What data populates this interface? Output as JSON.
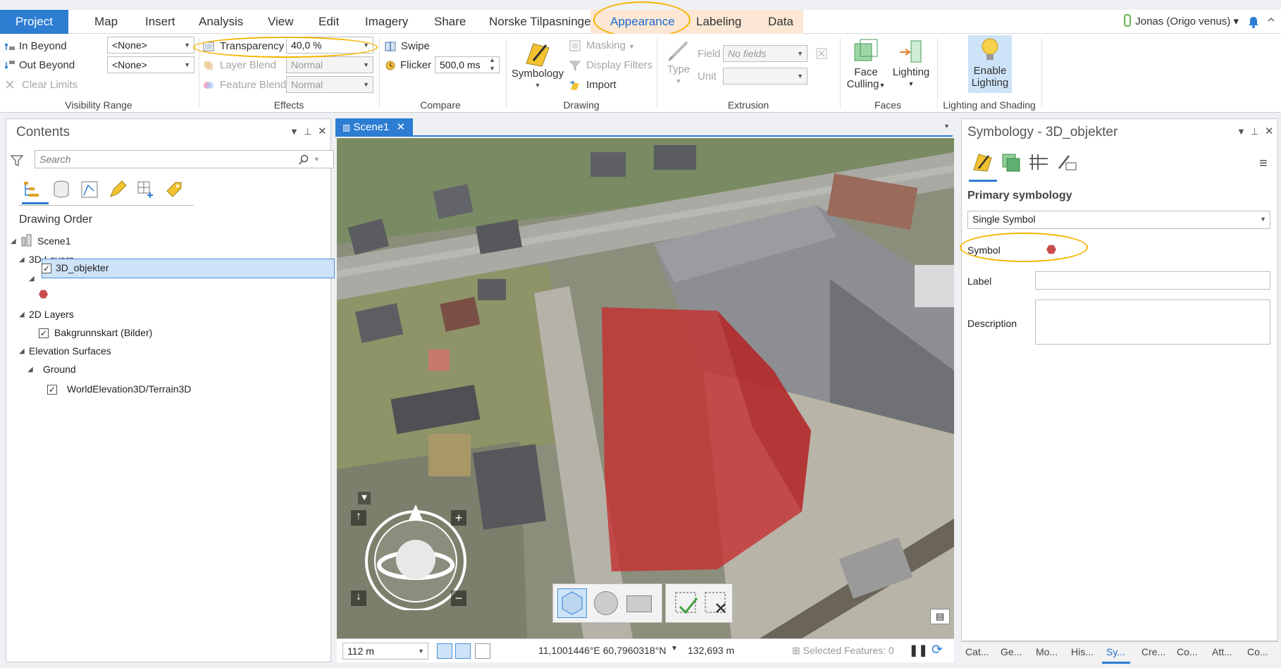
{
  "tabs": {
    "project": "Project",
    "map": "Map",
    "insert": "Insert",
    "analysis": "Analysis",
    "view": "View",
    "edit": "Edit",
    "imagery": "Imagery",
    "share": "Share",
    "norske": "Norske Tilpasninger",
    "appearance": "Appearance",
    "labeling": "Labeling",
    "data": "Data"
  },
  "user": {
    "name": "Jonas (Origo venus)",
    "caret": "▾"
  },
  "ribbon": {
    "visibility": {
      "in_beyond": "In Beyond",
      "out_beyond": "Out Beyond",
      "clear_limits": "Clear Limits",
      "in_value": "<None>",
      "out_value": "<None>",
      "label": "Visibility Range"
    },
    "effects": {
      "transparency": "Transparency",
      "transparency_value": "40,0 %",
      "layer_blend": "Layer Blend",
      "layer_blend_value": "Normal",
      "feature_blend": "Feature Blend",
      "feature_blend_value": "Normal",
      "label": "Effects"
    },
    "compare": {
      "swipe": "Swipe",
      "flicker": "Flicker",
      "flicker_value": "500,0  ms",
      "label": "Compare"
    },
    "drawing": {
      "symbology": "Symbology",
      "masking": "Masking",
      "display_filters": "Display Filters",
      "import": "Import",
      "label": "Drawing"
    },
    "extrusion": {
      "type": "Type",
      "field": "Field",
      "field_value": "No fields",
      "unit": "Unit",
      "label": "Extrusion"
    },
    "faces": {
      "face_culling_1": "Face",
      "face_culling_2": "Culling",
      "lighting": "Lighting",
      "label": "Faces"
    },
    "lighting_shading": {
      "enable_1": "Enable",
      "enable_2": "Lighting",
      "label": "Lighting and Shading"
    }
  },
  "contents": {
    "title": "Contents",
    "search_placeholder": "Search",
    "drawing_order": "Drawing Order",
    "scene": "Scene1",
    "layers_3d": "3D Layers",
    "layer_3d_item": "3D_objekter",
    "layers_2d": "2D Layers",
    "layer_2d_item": "Bakgrunnskart (Bilder)",
    "elevation": "Elevation Surfaces",
    "ground": "Ground",
    "terrain": "WorldElevation3D/Terrain3D"
  },
  "map": {
    "tab": "Scene1",
    "scale": "112 m",
    "coords": "11,1001446°E 60,7960318°N",
    "elevation": "132,693 m",
    "selected": "Selected Features: 0"
  },
  "symbology": {
    "title": "Symbology - 3D_objekter",
    "primary": "Primary symbology",
    "method": "Single Symbol",
    "symbol": "Symbol",
    "label": "Label",
    "description": "Description"
  },
  "bottom_tabs": [
    "Cat...",
    "Ge...",
    "Mo...",
    "His...",
    "Sy...",
    "Cre...",
    "Co...",
    "Att...",
    "Co..."
  ],
  "colors": {
    "accent": "#2d7dd2",
    "highlight_ring": "#f5b400",
    "symbol_red": "#c74c4c",
    "context_tab": "#fbe7d4"
  }
}
